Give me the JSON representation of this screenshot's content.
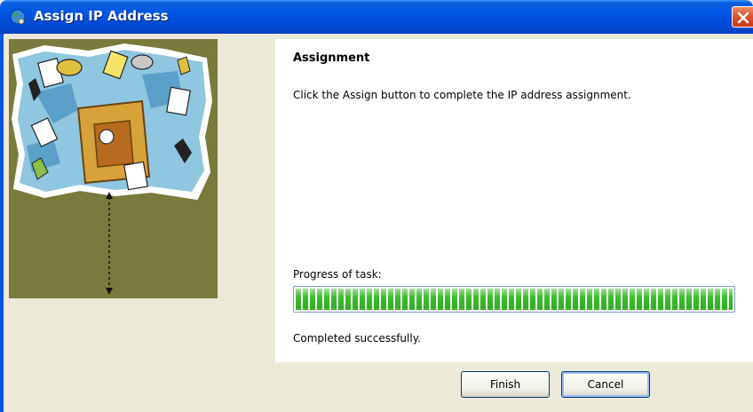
{
  "window": {
    "title": "Assign IP Address"
  },
  "banner": {
    "image": "network-illustration"
  },
  "content": {
    "heading": "Assignment",
    "description": "Click the Assign button to complete the IP address assignment.",
    "progress_label": "Progress of task:",
    "progress_value": 1.0,
    "status": "Completed successfully."
  },
  "buttons": {
    "finish": "Finish",
    "cancel": "Cancel"
  },
  "colors": {
    "titlebar": "#0055e5",
    "progress": "#3cbc2c",
    "banner_bg": "#7a7a3c",
    "dialog_bg": "#ece9d8"
  }
}
